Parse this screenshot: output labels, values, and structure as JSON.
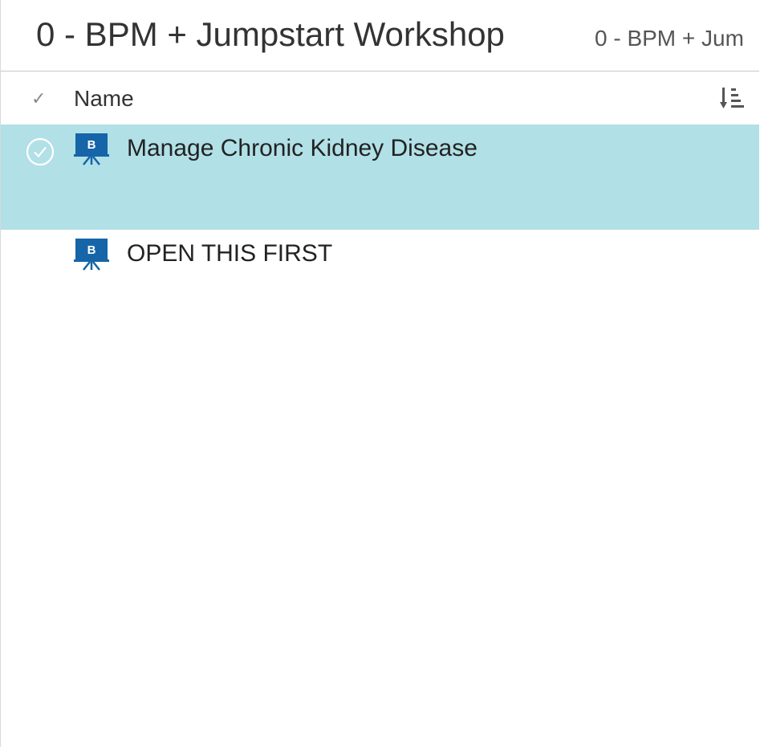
{
  "header": {
    "title": "0 - BPM + Jumpstart Workshop",
    "breadcrumb": "0 - BPM + Jum"
  },
  "columns": {
    "name_label": "Name",
    "check_icon": "checkmark-icon",
    "sort_icon": "sort-icon"
  },
  "items": [
    {
      "name": "Manage Chronic Kidney Disease",
      "icon": "presentation-board-icon",
      "icon_letter": "B",
      "selected": true
    },
    {
      "name": "OPEN THIS FIRST",
      "icon": "presentation-board-icon",
      "icon_letter": "B",
      "selected": false
    }
  ],
  "colors": {
    "selected_row": "#b1e0e7",
    "icon_blue": "#1565a8",
    "text": "#333333"
  }
}
